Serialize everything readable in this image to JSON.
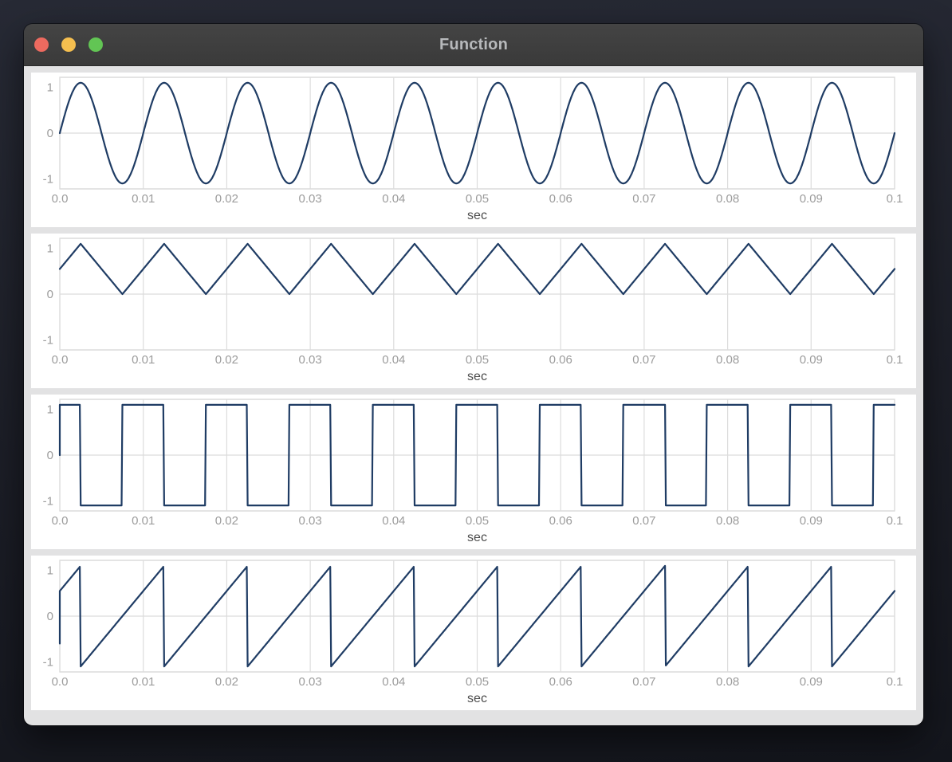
{
  "window": {
    "title": "Function",
    "controls": [
      {
        "name": "close",
        "color": "#ed6a5f"
      },
      {
        "name": "minimize",
        "color": "#f5bf4f"
      },
      {
        "name": "zoom",
        "color": "#62c554"
      }
    ]
  },
  "colors": {
    "titlebar_bg": "#3e3e3e",
    "title_text": "#b7b9bb",
    "content_bg": "#e2e2e3",
    "panel_bg": "#ffffff",
    "plot_border": "#d3d3d3",
    "grid_line": "#dcdcdc",
    "tick_label": "#9c9c9c",
    "axis_label": "#4b4b4b",
    "waveform_line": "#1f3c64"
  },
  "chart_data": [
    {
      "type": "line",
      "name": "sine",
      "waveform": "sine",
      "frequency_hz": 100,
      "period_s": 0.01,
      "amplitude": 1.1,
      "value_range": [
        -1.1,
        1.1
      ],
      "start_value": 0,
      "cycles_shown": 10,
      "initial_points": [],
      "xlabel": "sec",
      "xlim": [
        0,
        0.1
      ],
      "ylim": [
        -1.22,
        1.22
      ],
      "xticks": [
        "0.0",
        "0.01",
        "0.02",
        "0.03",
        "0.04",
        "0.05",
        "0.06",
        "0.07",
        "0.08",
        "0.09",
        "0.1"
      ],
      "yticks": [
        "1",
        "0",
        "-1"
      ],
      "grid": "vertical-gridlines-and-zero-line",
      "legend": "none"
    },
    {
      "type": "line",
      "name": "triangle",
      "waveform": "triangle",
      "frequency_hz": 100,
      "period_s": 0.01,
      "amplitude": 1.1,
      "value_range": [
        0,
        1.1
      ],
      "start_value": 0.55,
      "peak_times_s": "0.0025 + 0.01k",
      "min_times_s": "0.0075 + 0.01k",
      "cycles_shown": 10,
      "initial_points": [],
      "xlabel": "sec",
      "xlim": [
        0,
        0.1
      ],
      "ylim": [
        -1.22,
        1.22
      ],
      "xticks": [
        "0.0",
        "0.01",
        "0.02",
        "0.03",
        "0.04",
        "0.05",
        "0.06",
        "0.07",
        "0.08",
        "0.09",
        "0.1"
      ],
      "yticks": [
        "1",
        "0",
        "-1"
      ],
      "grid": "vertical-gridlines-and-zero-line",
      "legend": "none"
    },
    {
      "type": "line",
      "name": "square",
      "waveform": "square",
      "frequency_hz": 100,
      "period_s": 0.01,
      "amplitude": 1.1,
      "value_range": [
        -1.1,
        1.1
      ],
      "duty_cycle": 0.5,
      "high_intervals_s": "(k*0.01 - 0.0025, k*0.01 + 0.0025)",
      "transition_times_s": "0.0025 + 0.005k",
      "cycles_shown": 10,
      "initial_points": [
        [
          0,
          0
        ]
      ],
      "xlabel": "sec",
      "xlim": [
        0,
        0.1
      ],
      "ylim": [
        -1.22,
        1.22
      ],
      "xticks": [
        "0.0",
        "0.01",
        "0.02",
        "0.03",
        "0.04",
        "0.05",
        "0.06",
        "0.07",
        "0.08",
        "0.09",
        "0.1"
      ],
      "yticks": [
        "1",
        "0",
        "-1"
      ],
      "grid": "vertical-gridlines-and-zero-line",
      "legend": "none"
    },
    {
      "type": "line",
      "name": "sawtooth",
      "waveform": "sawtooth",
      "frequency_hz": 100,
      "period_s": 0.01,
      "amplitude": 1.1,
      "value_range": [
        -1.1,
        1.1
      ],
      "start_value": 0.55,
      "peak_times_s": "0.0025 + 0.01k",
      "drop_to": -1.1,
      "cycles_shown": 10,
      "initial_points": [
        [
          0,
          -0.6
        ]
      ],
      "xlabel": "sec",
      "xlim": [
        0,
        0.1
      ],
      "ylim": [
        -1.22,
        1.22
      ],
      "xticks": [
        "0.0",
        "0.01",
        "0.02",
        "0.03",
        "0.04",
        "0.05",
        "0.06",
        "0.07",
        "0.08",
        "0.09",
        "0.1"
      ],
      "yticks": [
        "1",
        "0",
        "-1"
      ],
      "grid": "vertical-gridlines-and-zero-line",
      "legend": "none"
    }
  ]
}
